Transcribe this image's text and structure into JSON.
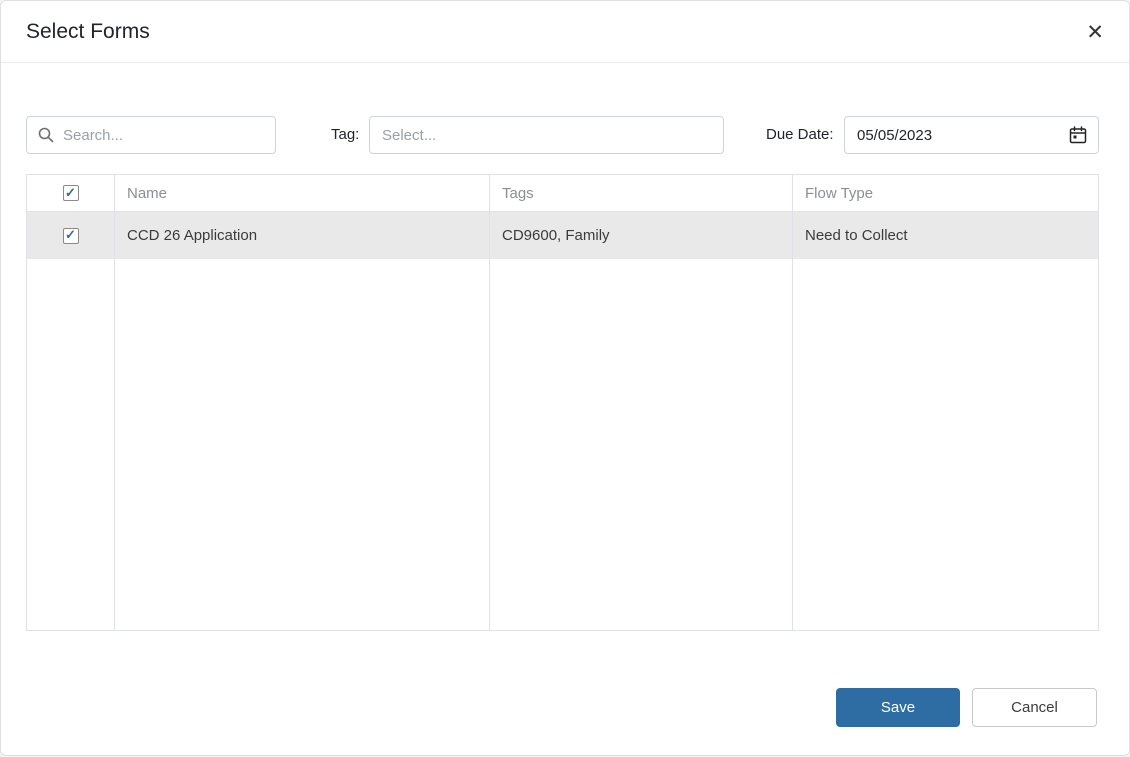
{
  "modal": {
    "title": "Select Forms"
  },
  "icons": {
    "close": "✕",
    "check": "✓",
    "search": "magnifier",
    "calendar": "calendar"
  },
  "filters": {
    "search": {
      "placeholder": "Search..."
    },
    "tag": {
      "label": "Tag:",
      "placeholder": "Select..."
    },
    "due_date": {
      "label": "Due Date:",
      "value": "05/05/2023"
    }
  },
  "table": {
    "header": {
      "checked": true,
      "columns": [
        "Name",
        "Tags",
        "Flow Type"
      ]
    },
    "rows": [
      {
        "checked": true,
        "name": "CCD 26 Application",
        "tags": "CD9600, Family",
        "flow_type": "Need to Collect"
      }
    ]
  },
  "footer": {
    "save": "Save",
    "cancel": "Cancel"
  },
  "colors": {
    "primary": "#2e6da4",
    "selected_row_bg": "#e9e9e9",
    "table_border": "#dee2e6",
    "header_text": "#8a8f94"
  }
}
